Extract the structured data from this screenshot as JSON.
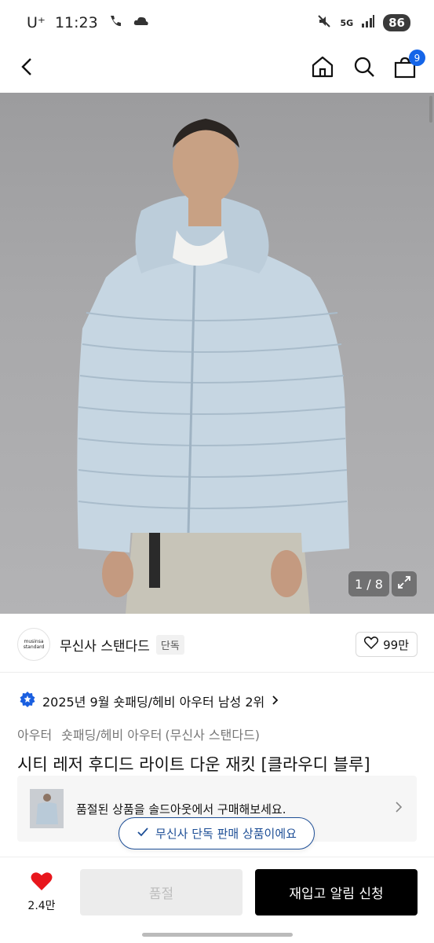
{
  "status_bar": {
    "carrier": "U⁺",
    "time": "11:23",
    "network": "5G",
    "battery": "86"
  },
  "nav": {
    "cart_count": "9"
  },
  "gallery": {
    "counter": "1 / 8"
  },
  "brand": {
    "logo_line1": "musinsa",
    "logo_line2": "standard",
    "name": "무신사 스탠다드",
    "exclusive_tag": "단독",
    "likes": "99만"
  },
  "ranking": {
    "text": "2025년 9월 숏패딩/헤비 아우터 남성 2위"
  },
  "breadcrumb": {
    "level1": "아우터",
    "level2": "숏패딩/헤비 아우터",
    "level3": "(무신사 스탠다드)"
  },
  "product": {
    "title": "시티 레저 후디드 라이트 다운 재킷 [클라우디 블루]"
  },
  "soldout_notice": {
    "text": "품절된 상품을 솔드아웃에서 구매해보세요."
  },
  "exclusive_pill": {
    "text": "무신사 단독 판매 상품이에요"
  },
  "bottom": {
    "favorite_count": "2.4만",
    "soldout_label": "품절",
    "restock_label": "재입고 알림 신청"
  },
  "colors": {
    "accent_blue": "#1565e8",
    "pill_navy": "#1d4e96",
    "heart_red": "#e8161c"
  }
}
